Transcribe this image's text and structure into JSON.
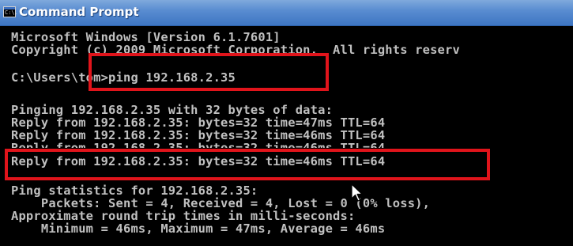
{
  "window": {
    "title": "Command Prompt",
    "icon_label": "C:\\."
  },
  "console": {
    "lines": [
      "Microsoft Windows [Version 6.1.7601]",
      "Copyright (c) 2009 Microsoft Corporation.  All rights reserv",
      "C:\\Users\\tom>ping 192.168.2.35",
      "Pinging 192.168.2.35 with 32 bytes of data:",
      "Reply from 192.168.2.35: bytes=32 time=47ms TTL=64",
      "Reply from 192.168.2.35: bytes=32 time=46ms TTL=64",
      "Reply from 192.168.2.35: bytes=32 time=46ms TTL=64",
      "Reply from 192.168.2.35: bytes=32 time=46ms TTL=64",
      "Ping statistics for 192.168.2.35:",
      "    Packets: Sent = 4, Received = 4, Lost = 0 (0% loss),",
      "Approximate round trip times in milli-seconds:",
      "    Minimum = 46ms, Maximum = 47ms, Average = 46ms"
    ]
  },
  "colors": {
    "console_background": "#000000",
    "console_text": "#c0c0c0",
    "highlight_box": "#e0141b",
    "titlebar": "#5a8dd1"
  }
}
